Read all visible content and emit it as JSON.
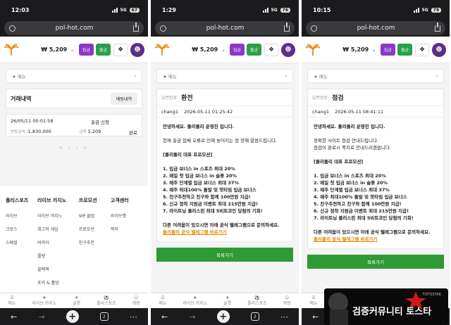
{
  "status_bar": [
    {
      "time": "12:03",
      "network": "5G",
      "battery": "67"
    },
    {
      "time": "1:29",
      "network": "5G",
      "battery": "76"
    },
    {
      "time": "10:15",
      "network": "5G",
      "battery": "79"
    }
  ],
  "url": "pol-hot.com",
  "header": {
    "balance": "₩ 5,209",
    "deposit": "입금",
    "withdraw": "출금"
  },
  "menu_label": "메뉴",
  "bottom_nav": [
    "메뉴",
    "라이브 카지노",
    "슬롯",
    "폴리스포츠",
    "계정"
  ],
  "tab_count": "2",
  "pane1": {
    "title": "거래내역",
    "history_btn": "배팅내역",
    "tx": {
      "date": "26/05/11 00:01:58",
      "type": "출금 신청",
      "amount_label": "변동금액",
      "amount": "-1,830,000",
      "balance_label": "금액",
      "balance": "5,209",
      "status": "완료"
    },
    "pager": "« ‹ › »",
    "footer": [
      {
        "title": "폴리스포츠",
        "items": [
          "라이브",
          "크로스",
          "스페셜"
        ]
      },
      {
        "title": "라이브 카지노",
        "items": [
          "라이브 카지노",
          "최고의 게임",
          "바카라",
          "룰렛",
          "블랙잭",
          "포커 & 홀덤"
        ]
      },
      {
        "title": "프로모션",
        "items": [
          "VIP 클럽",
          "프로모션",
          "친구추천"
        ]
      },
      {
        "title": "고객센터",
        "items": [
          "라이브챗",
          "쪽지"
        ]
      }
    ]
  },
  "pane2": {
    "badge": "답변완료",
    "title": "환전",
    "user": "chang1",
    "datetime": "2026-05-11 01:25:42",
    "greeting": "안녕하세요. 폴리폴리 운영진 입니다.",
    "body": [
      "현재 출금 업체 오류로 인해 늦어지는 점 양해 말씀드립니다."
    ]
  },
  "pane3": {
    "badge": "답변완료",
    "title": "점검",
    "user": "chang1",
    "datetime": "2026-05-11 08:41:11",
    "greeting": "안녕하세요. 폴리폴리 운영진 입니다.",
    "body": [
      "정확한 사이트 점검 안내드립니다.",
      "점검이 완료시 쪽지로 안내드리겠습니다."
    ]
  },
  "promo": {
    "heading": "[폴리폴리 대표 프로모션]",
    "items": [
      "1. 입금 보너스 in 스포츠 최대 20%",
      "2. 매일 첫 입금 보너스 in 슬롯 20%",
      "3. 매주 단계별 입금 보너스 최대 37%",
      "4. 매주 최대100% 돌발 및 핫타임 입금 보너스",
      "5. 친구추천하고 친구와 함께 100만원 지급!",
      "6. 신규 정착 지원금 이벤트 최대 215만원 지급!",
      "7. 라이트닝 폴리스핀 최대 5비트코인 당첨의 기회!"
    ],
    "closing": "다른 어려움이 있으시면 아래 공식 텔레그램으로 문의하세요.",
    "link": "폴리폴리 공식 텔레그램 바로가기"
  },
  "list_button": "목록가기",
  "watermark": {
    "text": "검증커뮤니티 토스타",
    "sub": "TOTOSTAR"
  }
}
